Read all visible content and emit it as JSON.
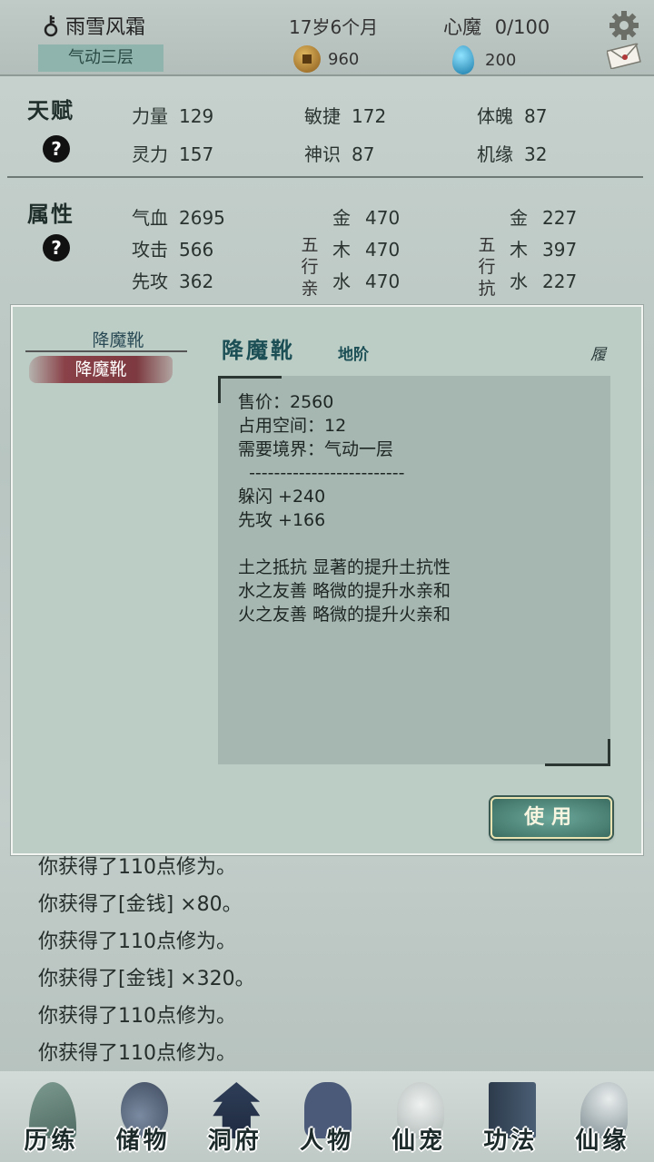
{
  "header": {
    "player_name": "雨雪风霜",
    "realm": "气动三层",
    "age": "17岁6个月",
    "demon_label": "心魔",
    "demon_value": "0/100",
    "coins": "960",
    "spirit_stones": "200",
    "icons": [
      "gender-icon",
      "coin-icon",
      "spirit-stone-icon",
      "settings-gear-icon",
      "mail-icon"
    ]
  },
  "talent": {
    "label": "天赋",
    "help": "?",
    "stats": [
      {
        "name": "力量",
        "value": "129"
      },
      {
        "name": "敏捷",
        "value": "172"
      },
      {
        "name": "体魄",
        "value": "87"
      },
      {
        "name": "灵力",
        "value": "157"
      },
      {
        "name": "神识",
        "value": "87"
      },
      {
        "name": "机缘",
        "value": "32"
      }
    ]
  },
  "attributes": {
    "label": "属性",
    "help": "?",
    "stats": [
      {
        "name": "气血",
        "value": "2695"
      },
      {
        "name": "攻击",
        "value": "566"
      },
      {
        "name": "先攻",
        "value": "362"
      }
    ],
    "affinity_label": [
      "五",
      "行",
      "亲"
    ],
    "affinity": [
      {
        "name": "金",
        "value": "470"
      },
      {
        "name": "木",
        "value": "470"
      },
      {
        "name": "水",
        "value": "470"
      }
    ],
    "resist_label": [
      "五",
      "行",
      "抗"
    ],
    "resist": [
      {
        "name": "金",
        "value": "227"
      },
      {
        "name": "木",
        "value": "397"
      },
      {
        "name": "水",
        "value": "227"
      }
    ]
  },
  "dialog": {
    "list_title": "降魔靴",
    "selected_item": "降魔靴",
    "item_name": "降魔靴",
    "item_grade": "地阶",
    "corner_mark": "履",
    "description_lines": [
      "售价：2560",
      "占用空间：12",
      "需要境界：气动一层",
      "  -------------------------",
      "躲闪 +240",
      "先攻 +166",
      "",
      "土之抵抗 显著的提升土抗性",
      "水之友善 略微的提升水亲和",
      "火之友善 略微的提升火亲和"
    ],
    "use_button": "使用"
  },
  "log": [
    "你获得了110点修为。",
    "你获得了[金钱] ×80。",
    "你获得了110点修为。",
    "你获得了[金钱] ×320。",
    "你获得了110点修为。",
    "你获得了110点修为。"
  ],
  "nav": [
    {
      "label": "历练",
      "icon": "mountain-icon",
      "color": "#5c7a72"
    },
    {
      "label": "储物",
      "icon": "pouch-icon",
      "color": "#5a6678"
    },
    {
      "label": "洞府",
      "icon": "pagoda-icon",
      "color": "#2f3e58"
    },
    {
      "label": "人物",
      "icon": "character-icon",
      "color": "#4a5a78"
    },
    {
      "label": "仙宠",
      "icon": "pet-ghost-icon",
      "color": "#cfd6d4"
    },
    {
      "label": "功法",
      "icon": "scripture-icon",
      "color": "#3a4a5e"
    },
    {
      "label": "仙缘",
      "icon": "crane-icon",
      "color": "#6a7a80"
    }
  ]
}
